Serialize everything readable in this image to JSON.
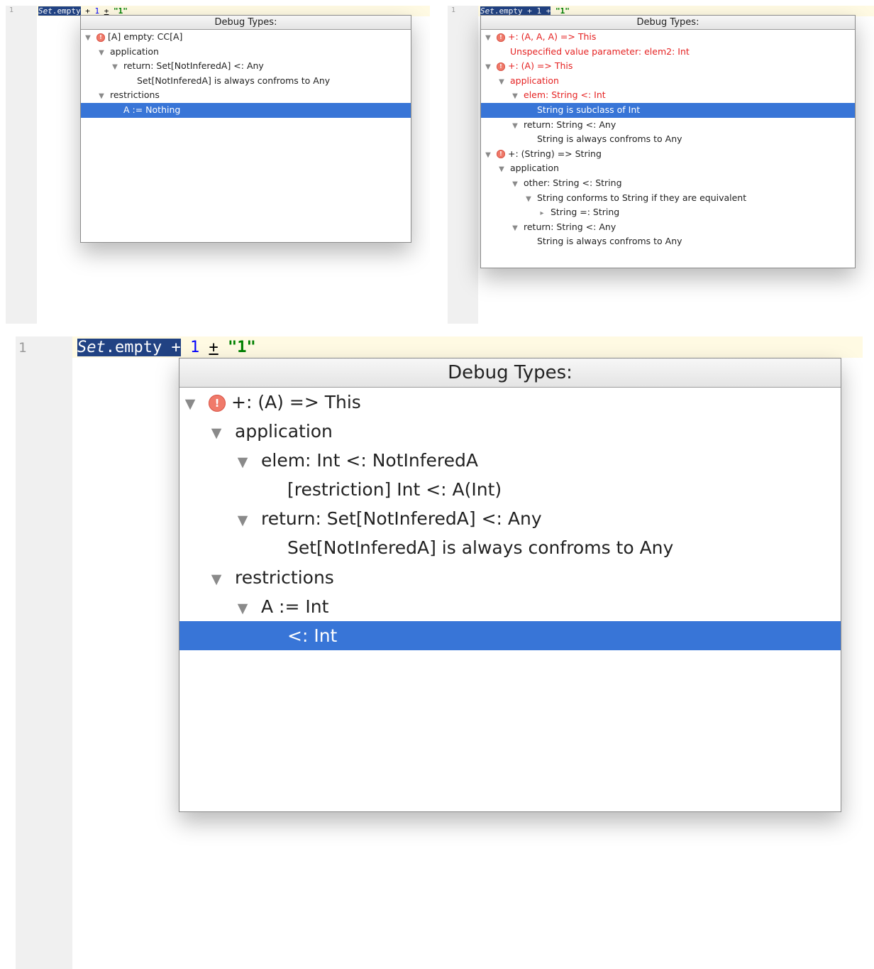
{
  "popup_title": "Debug Types:",
  "line_number": "1",
  "code": {
    "obj": "Set",
    "dot": ".",
    "method": "empty",
    "plus1": "+",
    "num": "1",
    "plus2": "+",
    "str": "\"1\""
  },
  "panels": [
    {
      "id": "top-left",
      "rows": [
        {
          "indent": 0,
          "triangle": "down",
          "error_icon": true,
          "text": "[A] empty: CC[A]"
        },
        {
          "indent": 1,
          "triangle": "down",
          "text": "application"
        },
        {
          "indent": 2,
          "triangle": "down",
          "text": "return: Set[NotInferedA] <: Any"
        },
        {
          "indent": 3,
          "triangle": "none",
          "text": "Set[NotInferedA] is always confroms to Any"
        },
        {
          "indent": 1,
          "triangle": "down",
          "text": "restrictions"
        },
        {
          "indent": 2,
          "triangle": "none",
          "text": "A := Nothing",
          "selected": true
        }
      ]
    },
    {
      "id": "top-right",
      "rows": [
        {
          "indent": 0,
          "triangle": "down",
          "error_icon": true,
          "text": "+: (A, A, A) => This",
          "error": true
        },
        {
          "indent": 1,
          "triangle": "none",
          "text": "Unspecified value parameter: elem2: Int",
          "error": true
        },
        {
          "indent": 0,
          "triangle": "down",
          "error_icon": true,
          "text": "+: (A) => This",
          "error": true
        },
        {
          "indent": 1,
          "triangle": "down",
          "text": "application",
          "error": true
        },
        {
          "indent": 2,
          "triangle": "down",
          "text": "elem: String <: Int",
          "error": true
        },
        {
          "indent": 3,
          "triangle": "none",
          "text": "String is subclass of Int",
          "selected": true
        },
        {
          "indent": 2,
          "triangle": "down",
          "text": "return: String <: Any"
        },
        {
          "indent": 3,
          "triangle": "none",
          "text": "String is always confroms to Any"
        },
        {
          "indent": 0,
          "triangle": "down",
          "error_icon": true,
          "text": "+: (String) => String"
        },
        {
          "indent": 1,
          "triangle": "down",
          "text": "application"
        },
        {
          "indent": 2,
          "triangle": "down",
          "text": "other: String <: String"
        },
        {
          "indent": 3,
          "triangle": "down",
          "text": "String conforms to String if they are equivalent"
        },
        {
          "indent": 4,
          "triangle": "right",
          "text": "String =: String"
        },
        {
          "indent": 2,
          "triangle": "down",
          "text": "return: String <: Any"
        },
        {
          "indent": 3,
          "triangle": "none",
          "text": "String is always confroms to Any"
        }
      ]
    },
    {
      "id": "bottom",
      "rows": [
        {
          "indent": 0,
          "triangle": "down",
          "error_icon": true,
          "text": "+: (A) => This"
        },
        {
          "indent": 1,
          "triangle": "down",
          "text": "application"
        },
        {
          "indent": 2,
          "triangle": "down",
          "text": "elem: Int <: NotInferedA"
        },
        {
          "indent": 3,
          "triangle": "none",
          "text": "[restriction] Int <: A(Int)"
        },
        {
          "indent": 2,
          "triangle": "down",
          "text": "return: Set[NotInferedA] <: Any"
        },
        {
          "indent": 3,
          "triangle": "none",
          "text": "Set[NotInferedA] is always confroms to Any"
        },
        {
          "indent": 1,
          "triangle": "down",
          "text": "restrictions"
        },
        {
          "indent": 2,
          "triangle": "down",
          "text": "A := Int"
        },
        {
          "indent": 3,
          "triangle": "none",
          "text": "<: Int",
          "selected": true
        }
      ]
    }
  ],
  "colors": {
    "selection": "#3875d7",
    "error_text": "#e52222",
    "error_icon": "#f07a6a",
    "code_selection": "#214283",
    "string_literal": "#008000",
    "number_literal": "#0000ff",
    "gutter": "#f0f0f0",
    "current_line": "#fffae3"
  },
  "icons": {
    "expanded": "triangle-down-icon",
    "collapsed": "triangle-right-icon",
    "error": "error-icon"
  }
}
